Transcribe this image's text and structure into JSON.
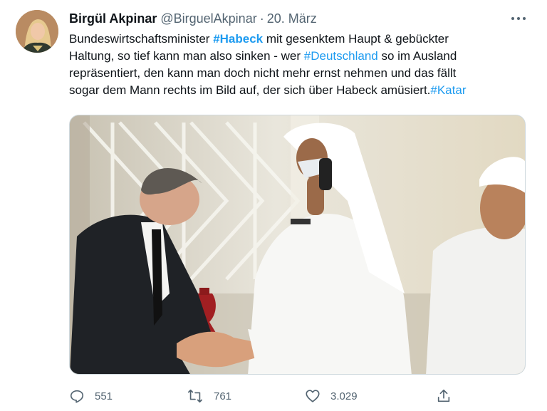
{
  "tweet": {
    "author": {
      "name": "Birgül Akpinar",
      "handle": "@BirguelAkpinar",
      "separator": "·",
      "date": "20. März"
    },
    "text": {
      "line1": {
        "a": "Bundeswirtschaftsminister ",
        "tag": "#Habeck",
        "b": " mit gesenktem Haupt & gebückter"
      },
      "line2": {
        "a": "Haltung, so tief kann man also sinken - wer ",
        "tag": "#Deutschland",
        "b": " so im Ausland"
      },
      "line3": "repräsentiert, den kann man doch nicht mehr ernst nehmen und das fällt",
      "line4": {
        "a": "sogar dem Mann rechts im Bild auf, der sich über Habeck amüsiert.",
        "tag": "#Katar"
      }
    },
    "actions": {
      "replies": "551",
      "retweets": "761",
      "likes": "3.029"
    },
    "colors": {
      "link": "#1d9bf0",
      "secondary_text": "#536471",
      "border": "#cfd9de"
    },
    "icons": [
      "more-icon",
      "reply-icon",
      "retweet-icon",
      "like-icon",
      "share-icon"
    ]
  }
}
